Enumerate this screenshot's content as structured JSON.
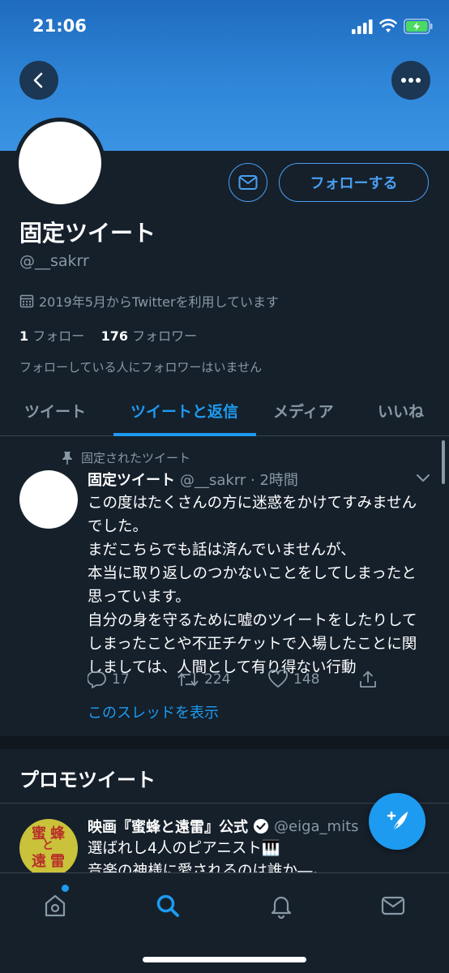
{
  "status_bar": {
    "time": "21:06"
  },
  "profile": {
    "display_name": "固定ツイート",
    "handle": "@__sakrr",
    "joined": "2019年5月からTwitterを利用しています",
    "following_count": "1",
    "following_label": "フォロー",
    "followers_count": "176",
    "followers_label": "フォロワー",
    "followed_by": "フォローしている人にフォロワーはいません"
  },
  "actions": {
    "follow_label": "フォローする"
  },
  "tabs": [
    {
      "label": "ツイート",
      "active": false
    },
    {
      "label": "ツイートと返信",
      "active": true
    },
    {
      "label": "メディア",
      "active": false
    },
    {
      "label": "いいね",
      "active": false
    }
  ],
  "pinned_tweet": {
    "pin_label": "固定されたツイート",
    "name": "固定ツイート",
    "meta": "@__sakrr · 2時間",
    "lines": [
      "この度はたくさんの方に迷惑をかけてすみませんでした。",
      "まだこちらでも話は済んでいませんが、",
      "本当に取り返しのつかないことをしてしまったと思っています。",
      "自分の身を守るために嘘のツイートをしたりしてしまったことや不正チケットで入場したことに関しましては、人間として有り得ない行動"
    ],
    "replies": "17",
    "retweets": "224",
    "likes": "148",
    "thread_link": "このスレッドを表示"
  },
  "promo_section": {
    "title": "プロモツイート",
    "name": "映画『蜜蜂と遠雷』公式",
    "handle": "@eiga_mits",
    "line1": "選ばれし4人のピアニスト🎹",
    "line2": "音楽の神様に愛されるのは誰か―。",
    "avatar_text": [
      "蜜",
      "蜂",
      "と",
      "遠",
      "雷"
    ]
  },
  "colors": {
    "accent": "#1d9bf0",
    "background": "#15202b",
    "muted": "#8899a6",
    "banner": "#2f86d8"
  },
  "icons": [
    "back-arrow-icon",
    "more-icon",
    "mail-icon",
    "calendar-icon",
    "pin-icon",
    "reply-icon",
    "retweet-icon",
    "like-icon",
    "share-icon",
    "chevron-down-icon",
    "verified-icon",
    "compose-icon",
    "home-icon",
    "search-icon",
    "bell-icon",
    "messages-icon"
  ]
}
